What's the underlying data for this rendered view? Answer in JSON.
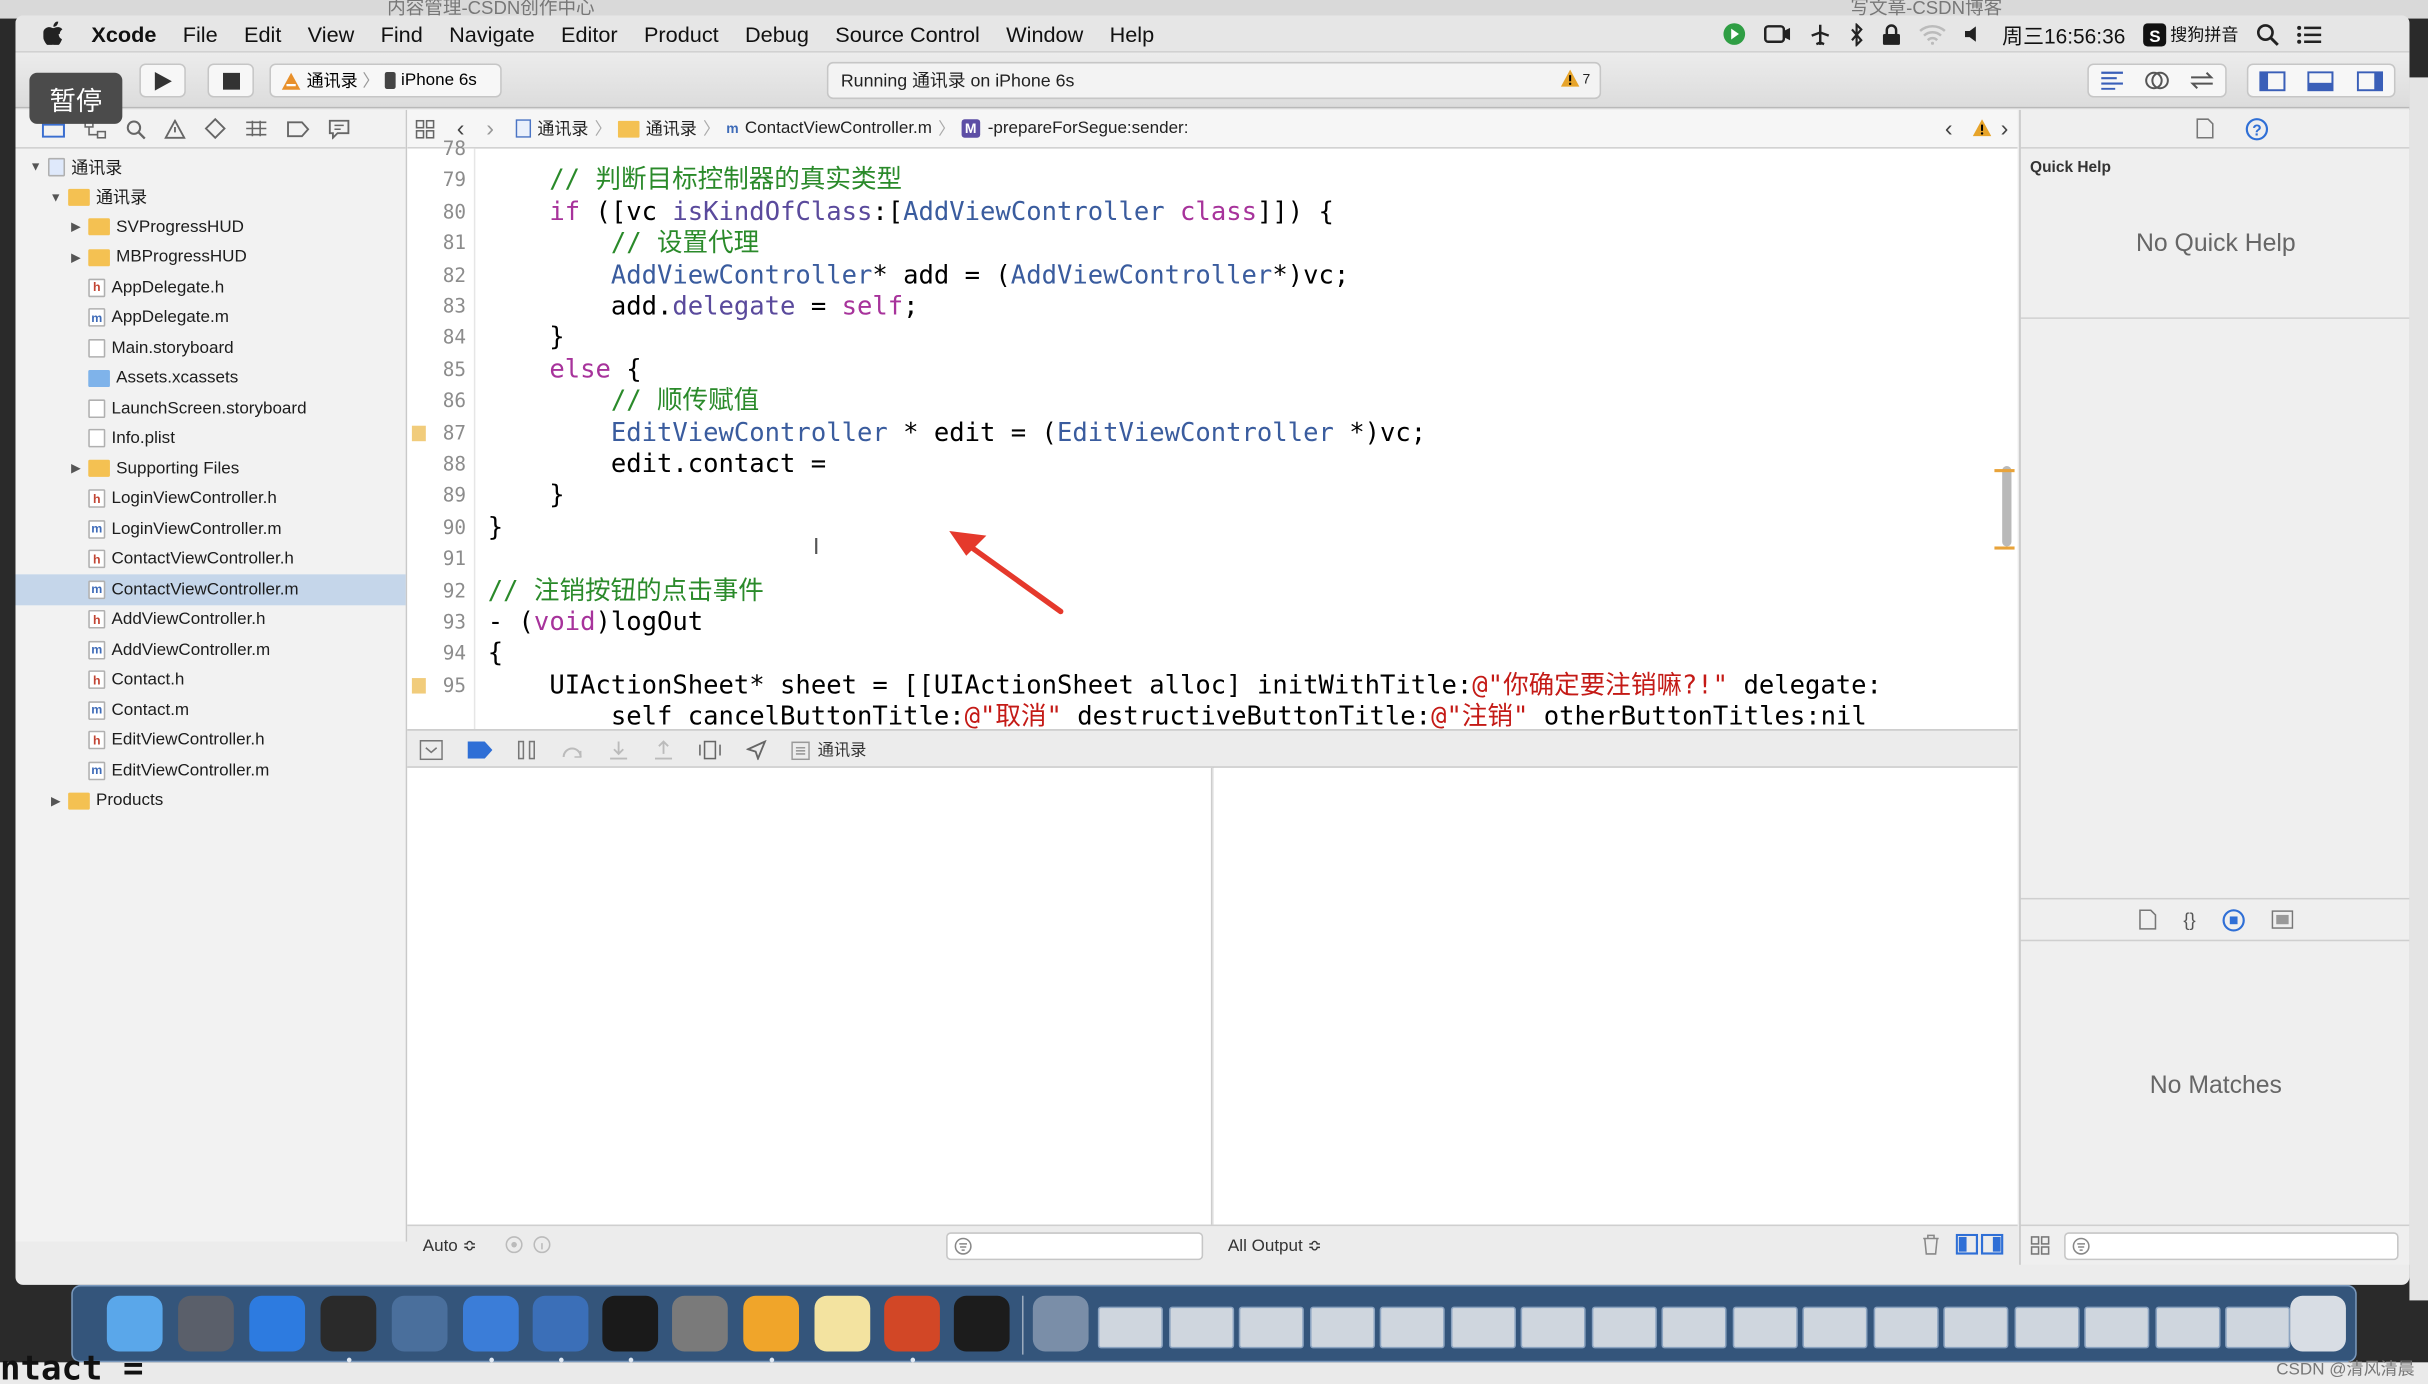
{
  "browser_tabs": [
    "内容管理-CSDN创作中心",
    "写文章-CSDN博客"
  ],
  "overlay_badge": "暂停",
  "menubar": {
    "app": "Xcode",
    "items": [
      "File",
      "Edit",
      "View",
      "Find",
      "Navigate",
      "Editor",
      "Product",
      "Debug",
      "Source Control",
      "Window",
      "Help"
    ],
    "clock": "周三16:56:36",
    "ime": "搜狗拼音"
  },
  "toolbar": {
    "scheme": "通讯录",
    "device": "iPhone 6s",
    "status": "Running 通讯录 on iPhone 6s",
    "warning_count": "7"
  },
  "navigator": {
    "rows": [
      {
        "label": "通讯录",
        "kind": "project",
        "depth": 0,
        "disclosure": "▼"
      },
      {
        "label": "通讯录",
        "kind": "folder",
        "depth": 1,
        "disclosure": "▼"
      },
      {
        "label": "SVProgressHUD",
        "kind": "folder",
        "depth": 2,
        "disclosure": "▶"
      },
      {
        "label": "MBProgressHUD",
        "kind": "folder",
        "depth": 2,
        "disclosure": "▶"
      },
      {
        "label": "AppDelegate.h",
        "kind": "h",
        "depth": 2
      },
      {
        "label": "AppDelegate.m",
        "kind": "m",
        "depth": 2
      },
      {
        "label": "Main.storyboard",
        "kind": "x",
        "depth": 2
      },
      {
        "label": "Assets.xcassets",
        "kind": "assets",
        "depth": 2
      },
      {
        "label": "LaunchScreen.storyboard",
        "kind": "x",
        "depth": 2
      },
      {
        "label": "Info.plist",
        "kind": "x",
        "depth": 2
      },
      {
        "label": "Supporting Files",
        "kind": "folder",
        "depth": 2,
        "disclosure": "▶"
      },
      {
        "label": "LoginViewController.h",
        "kind": "h",
        "depth": 2
      },
      {
        "label": "LoginViewController.m",
        "kind": "m",
        "depth": 2
      },
      {
        "label": "ContactViewController.h",
        "kind": "h",
        "depth": 2
      },
      {
        "label": "ContactViewController.m",
        "kind": "m",
        "depth": 2,
        "selected": true
      },
      {
        "label": "AddViewController.h",
        "kind": "h",
        "depth": 2
      },
      {
        "label": "AddViewController.m",
        "kind": "m",
        "depth": 2
      },
      {
        "label": "Contact.h",
        "kind": "h",
        "depth": 2
      },
      {
        "label": "Contact.m",
        "kind": "m",
        "depth": 2
      },
      {
        "label": "EditViewController.h",
        "kind": "h",
        "depth": 2
      },
      {
        "label": "EditViewController.m",
        "kind": "m",
        "depth": 2
      },
      {
        "label": "Products",
        "kind": "folder",
        "depth": 1,
        "disclosure": "▶"
      }
    ]
  },
  "jumpbar": {
    "crumbs": [
      "通讯录",
      "通讯录",
      "ContactViewController.m",
      "-prepareForSegue:sender:"
    ],
    "method_badge": "M"
  },
  "editor": {
    "lines": [
      {
        "n": "78",
        "segs": []
      },
      {
        "n": "79",
        "segs": [
          {
            "t": "    // 判断目标控制器的真实类型",
            "c": "cm"
          }
        ]
      },
      {
        "n": "80",
        "segs": [
          {
            "t": "    ",
            "c": ""
          },
          {
            "t": "if",
            "c": "kw"
          },
          {
            "t": " ([vc ",
            "c": ""
          },
          {
            "t": "isKindOfClass",
            "c": "pr"
          },
          {
            "t": ":[",
            "c": ""
          },
          {
            "t": "AddViewController",
            "c": "ty"
          },
          {
            "t": " ",
            "c": ""
          },
          {
            "t": "class",
            "c": "kw"
          },
          {
            "t": "]]) {",
            "c": ""
          }
        ]
      },
      {
        "n": "81",
        "segs": [
          {
            "t": "        // 设置代理",
            "c": "cm"
          }
        ]
      },
      {
        "n": "82",
        "segs": [
          {
            "t": "        ",
            "c": ""
          },
          {
            "t": "AddViewController",
            "c": "ty"
          },
          {
            "t": "* add = (",
            "c": ""
          },
          {
            "t": "AddViewController",
            "c": "ty"
          },
          {
            "t": "*)vc;",
            "c": ""
          }
        ]
      },
      {
        "n": "83",
        "segs": [
          {
            "t": "        add.",
            "c": ""
          },
          {
            "t": "delegate",
            "c": "pr"
          },
          {
            "t": " = ",
            "c": ""
          },
          {
            "t": "self",
            "c": "kw"
          },
          {
            "t": ";",
            "c": ""
          }
        ]
      },
      {
        "n": "84",
        "segs": [
          {
            "t": "    }",
            "c": ""
          }
        ]
      },
      {
        "n": "85",
        "segs": [
          {
            "t": "    ",
            "c": ""
          },
          {
            "t": "else",
            "c": "kw"
          },
          {
            "t": " {",
            "c": ""
          }
        ]
      },
      {
        "n": "86",
        "segs": [
          {
            "t": "        // 顺传赋值",
            "c": "cm"
          }
        ]
      },
      {
        "n": "87",
        "segs": [
          {
            "t": "        ",
            "c": ""
          },
          {
            "t": "EditViewController",
            "c": "ty"
          },
          {
            "t": " * edit = (",
            "c": ""
          },
          {
            "t": "EditViewController",
            "c": "ty"
          },
          {
            "t": " *)vc;",
            "c": ""
          }
        ],
        "warn": true
      },
      {
        "n": "88",
        "segs": [
          {
            "t": "        edit.contact =",
            "c": ""
          }
        ]
      },
      {
        "n": "89",
        "segs": [
          {
            "t": "    }",
            "c": ""
          }
        ]
      },
      {
        "n": "90",
        "segs": [
          {
            "t": "}",
            "c": ""
          }
        ]
      },
      {
        "n": "91",
        "segs": []
      },
      {
        "n": "92",
        "segs": [
          {
            "t": "// 注销按钮的点击事件",
            "c": "cm"
          }
        ]
      },
      {
        "n": "93",
        "segs": [
          {
            "t": "- (",
            "c": ""
          },
          {
            "t": "void",
            "c": "kw"
          },
          {
            "t": ")logOut",
            "c": ""
          }
        ]
      },
      {
        "n": "94",
        "segs": [
          {
            "t": "{",
            "c": ""
          }
        ]
      },
      {
        "n": "95",
        "segs": [
          {
            "t": "    ",
            "c": ""
          },
          {
            "t": "UIActionSheet",
            "c": ""
          },
          {
            "t": "* sheet = [[",
            "c": ""
          },
          {
            "t": "UIActionSheet",
            "c": ""
          },
          {
            "t": " ",
            "c": ""
          },
          {
            "t": "alloc",
            "c": ""
          },
          {
            "t": "] ",
            "c": ""
          },
          {
            "t": "initWithTitle",
            "c": ""
          },
          {
            "t": ":",
            "c": ""
          },
          {
            "t": "@\"你确定要注销嘛?!\"",
            "c": "st"
          },
          {
            "t": " delegate:",
            "c": ""
          }
        ],
        "warn": true
      },
      {
        "n": "",
        "segs": [
          {
            "t": "        self cancelButtonTitle:",
            "c": ""
          },
          {
            "t": "@\"取消\"",
            "c": "st"
          },
          {
            "t": " destructiveButtonTitle:",
            "c": ""
          },
          {
            "t": "@\"注销\"",
            "c": "st"
          },
          {
            "t": " otherButtonTitles:nil",
            "c": ""
          }
        ]
      }
    ]
  },
  "debug": {
    "target": "通讯录",
    "auto_label": "Auto ≎",
    "output_label": "All Output ≎"
  },
  "inspector": {
    "title": "Quick Help",
    "empty": "No Quick Help",
    "library_empty": "No Matches"
  },
  "bottom_partial_text": "ntact =",
  "watermark": "CSDN @清风清晨",
  "colors": {
    "selection": "#c5d6ea",
    "arrow": "#e5392c",
    "comment": "#2a8a2a",
    "keyword": "#a7339b",
    "type": "#3a5c9e",
    "string": "#c41a16"
  }
}
